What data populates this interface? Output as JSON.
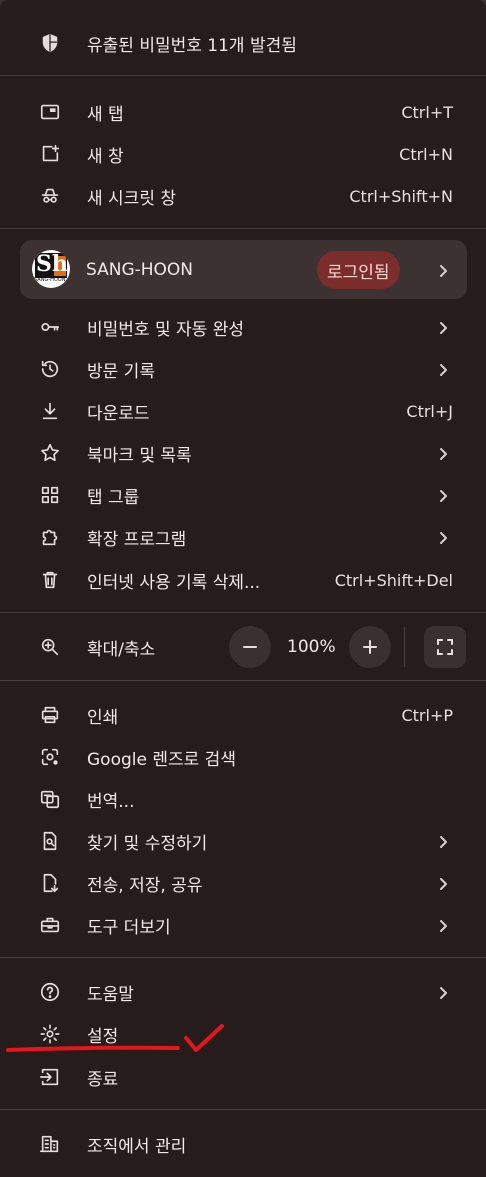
{
  "warning": {
    "label": "유출된 비밀번호 11개 발견됨"
  },
  "new_items": [
    {
      "label": "새 탭",
      "shortcut": "Ctrl+T"
    },
    {
      "label": "새 창",
      "shortcut": "Ctrl+N"
    },
    {
      "label": "새 시크릿 창",
      "shortcut": "Ctrl+Shift+N"
    }
  ],
  "profile": {
    "name": "SANG-HOON",
    "status": "로그인됨",
    "avatar_text": "Sh",
    "avatar_sub": "SANG-HOON"
  },
  "items": [
    {
      "label": "비밀번호 및 자동 완성"
    },
    {
      "label": "방문 기록"
    },
    {
      "label": "다운로드",
      "shortcut": "Ctrl+J"
    },
    {
      "label": "북마크 및 목록"
    },
    {
      "label": "탭 그룹"
    },
    {
      "label": "확장 프로그램"
    },
    {
      "label": "인터넷 사용 기록 삭제...",
      "shortcut": "Ctrl+Shift+Del"
    }
  ],
  "zoom": {
    "label": "확대/축소",
    "value": "100%"
  },
  "tools": [
    {
      "label": "인쇄",
      "shortcut": "Ctrl+P"
    },
    {
      "label": "Google 렌즈로 검색"
    },
    {
      "label": "번역..."
    },
    {
      "label": "찾기 및 수정하기"
    },
    {
      "label": "전송, 저장, 공유"
    },
    {
      "label": "도구 더보기"
    }
  ],
  "bottom": [
    {
      "label": "도움말"
    },
    {
      "label": "설정"
    },
    {
      "label": "종료"
    }
  ],
  "managed": {
    "label": "조직에서 관리"
  },
  "colors": {
    "menu_bg": "#271c1c",
    "badge_bg": "#7a2d2a",
    "annotation": "#e8141b"
  }
}
